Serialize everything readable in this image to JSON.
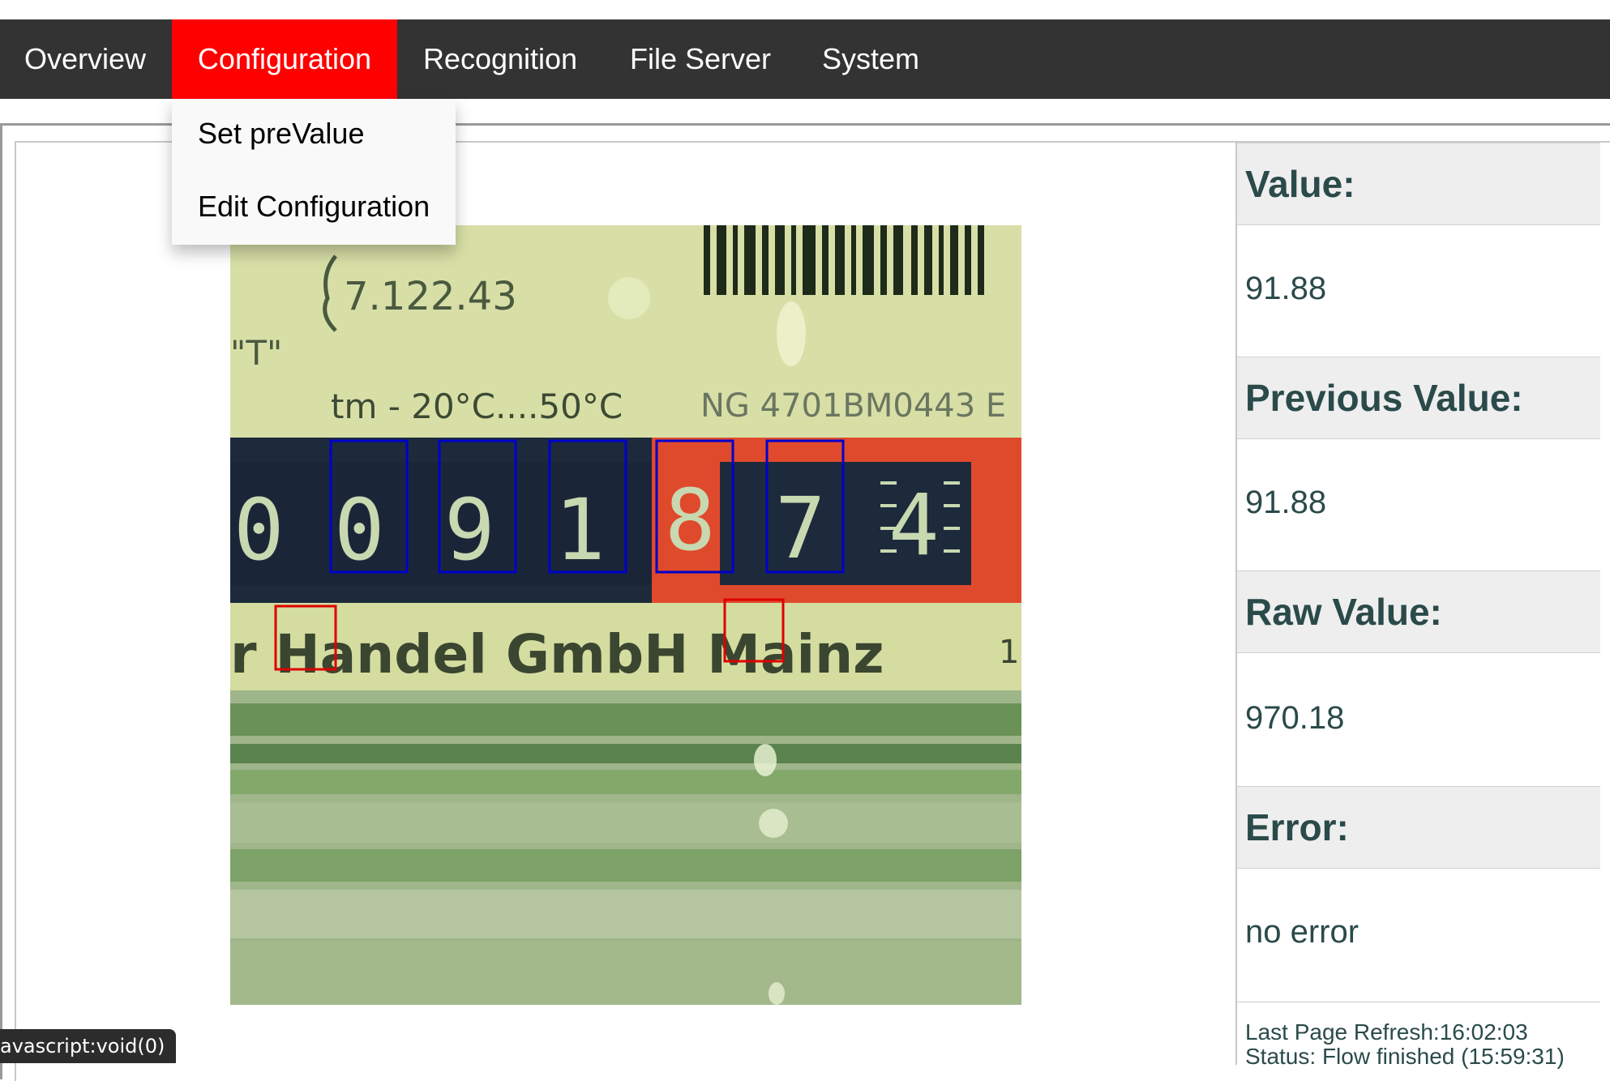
{
  "nav": {
    "items": [
      {
        "label": "Overview"
      },
      {
        "label": "Configuration"
      },
      {
        "label": "Recognition"
      },
      {
        "label": "File Server"
      },
      {
        "label": "System"
      }
    ],
    "active_index": 1,
    "active_color": "#ff0000",
    "bar_color": "#333333"
  },
  "dropdown": {
    "items": [
      {
        "label": "Set preValue"
      },
      {
        "label": "Edit Configuration"
      }
    ]
  },
  "image": {
    "printed_text": {
      "spec": "7.122.43",
      "quote_t": "\"T\"",
      "temp_range": "tm - 20°C....50°C",
      "serial": "NG 4701BM0443 E",
      "counter_digits": [
        "0",
        "0",
        "9",
        "1",
        "8",
        "7",
        "4"
      ],
      "maker": "r Handel GmbH Mainz",
      "trailing": "1"
    },
    "digit_roi_color": "#0000cc",
    "analog_roi_color": "#dd0000"
  },
  "sidebar": {
    "value_label": "Value:",
    "value": "91.88",
    "previous_label": "Previous Value:",
    "previous": "91.88",
    "raw_label": "Raw Value:",
    "raw": "970.18",
    "error_label": "Error:",
    "error": "no error",
    "last_refresh": "Last Page Refresh:16:02:03",
    "status": "Status: Flow finished (15:59:31)"
  },
  "statusbar": {
    "text": "avascript:void(0)"
  }
}
